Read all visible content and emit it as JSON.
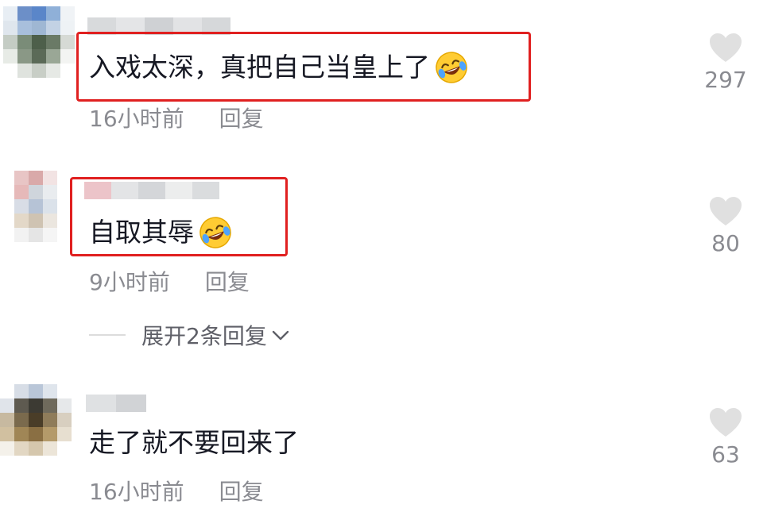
{
  "comments": [
    {
      "text": "入戏太深，真把自己当皇上了",
      "emoji": "rofl-emoji",
      "time": "16小时前",
      "reply_label": "回复",
      "likes": "297",
      "highlighted": true
    },
    {
      "text": "自取其辱",
      "emoji": "rofl-emoji",
      "time": "9小时前",
      "reply_label": "回复",
      "likes": "80",
      "highlighted": true
    },
    {
      "text": "走了就不要回来了",
      "time": "16小时前",
      "reply_label": "回复",
      "likes": "63",
      "highlighted": false
    }
  ],
  "expand_replies": {
    "label": "展开2条回复"
  },
  "colors": {
    "highlight": "#e02020",
    "meta_text": "#8a8b91",
    "like_icon": "#e0e0e0"
  },
  "icons": {
    "like": "heart-icon",
    "expand": "chevron-down-icon"
  }
}
